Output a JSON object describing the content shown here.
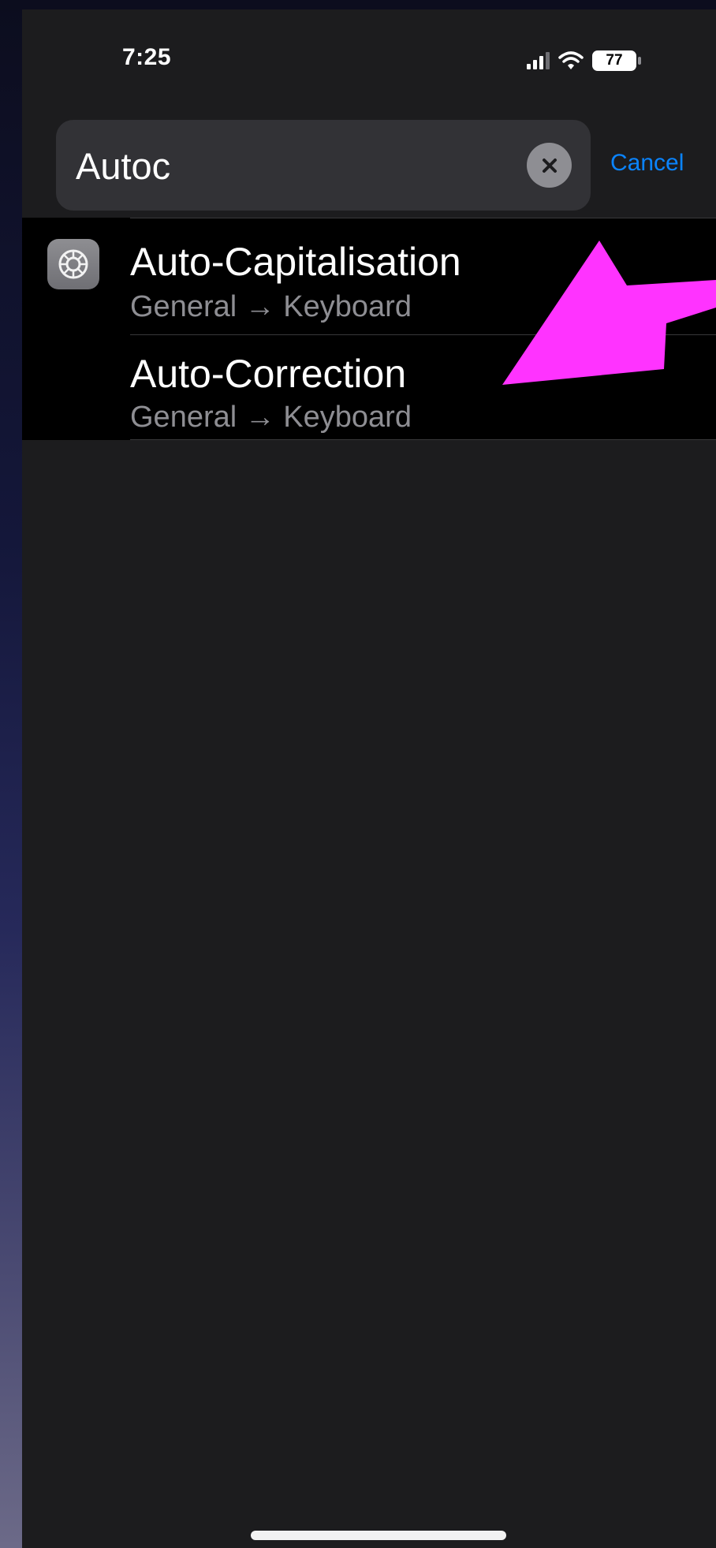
{
  "status_bar": {
    "time": "7:25",
    "battery_level": "77"
  },
  "search": {
    "query": "Autoc",
    "cancel_label": "Cancel"
  },
  "results": [
    {
      "title": "Auto-Capitalisation",
      "path": "General → Keyboard",
      "icon": "settings-gear-icon"
    },
    {
      "title": "Auto-Correction",
      "path": "General → Keyboard"
    }
  ],
  "colors": {
    "accent": "#0a84ff",
    "annotation_arrow": "#ff33ff",
    "background": "#1c1c1e"
  }
}
